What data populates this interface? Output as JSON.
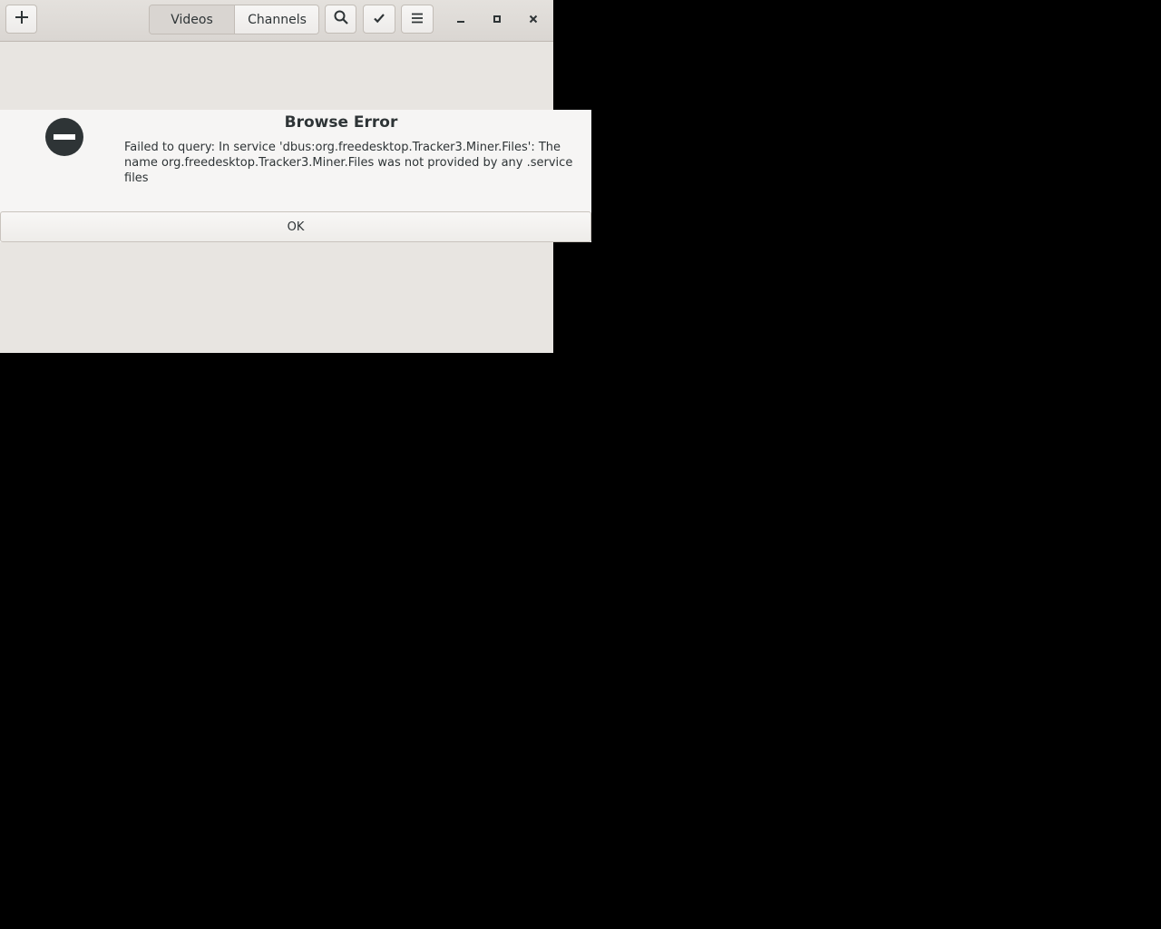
{
  "header": {
    "add_icon": "plus-icon",
    "view_switcher": {
      "tabs": [
        {
          "label": "Videos",
          "active": true
        },
        {
          "label": "Channels",
          "active": false
        }
      ]
    },
    "search_icon": "magnifier-icon",
    "select_icon": "checkmark-icon",
    "menu_icon": "hamburger-menu-icon",
    "window_controls": [
      "minimize-icon",
      "maximize-icon",
      "close-icon"
    ]
  },
  "dialog": {
    "icon": "error-no-entry-icon",
    "title": "Browse Error",
    "message": "Failed to query: In service 'dbus:org.freedesktop.Tracker3.Miner.Files': The name org.freedesktop.Tracker3.Miner.Files was not provided by any .service files",
    "ok_label": "OK"
  },
  "colors": {
    "desktop_background": "#000000",
    "window_background": "#e8e5e1",
    "dialog_background": "#f6f5f4",
    "text": "#2e3436"
  }
}
